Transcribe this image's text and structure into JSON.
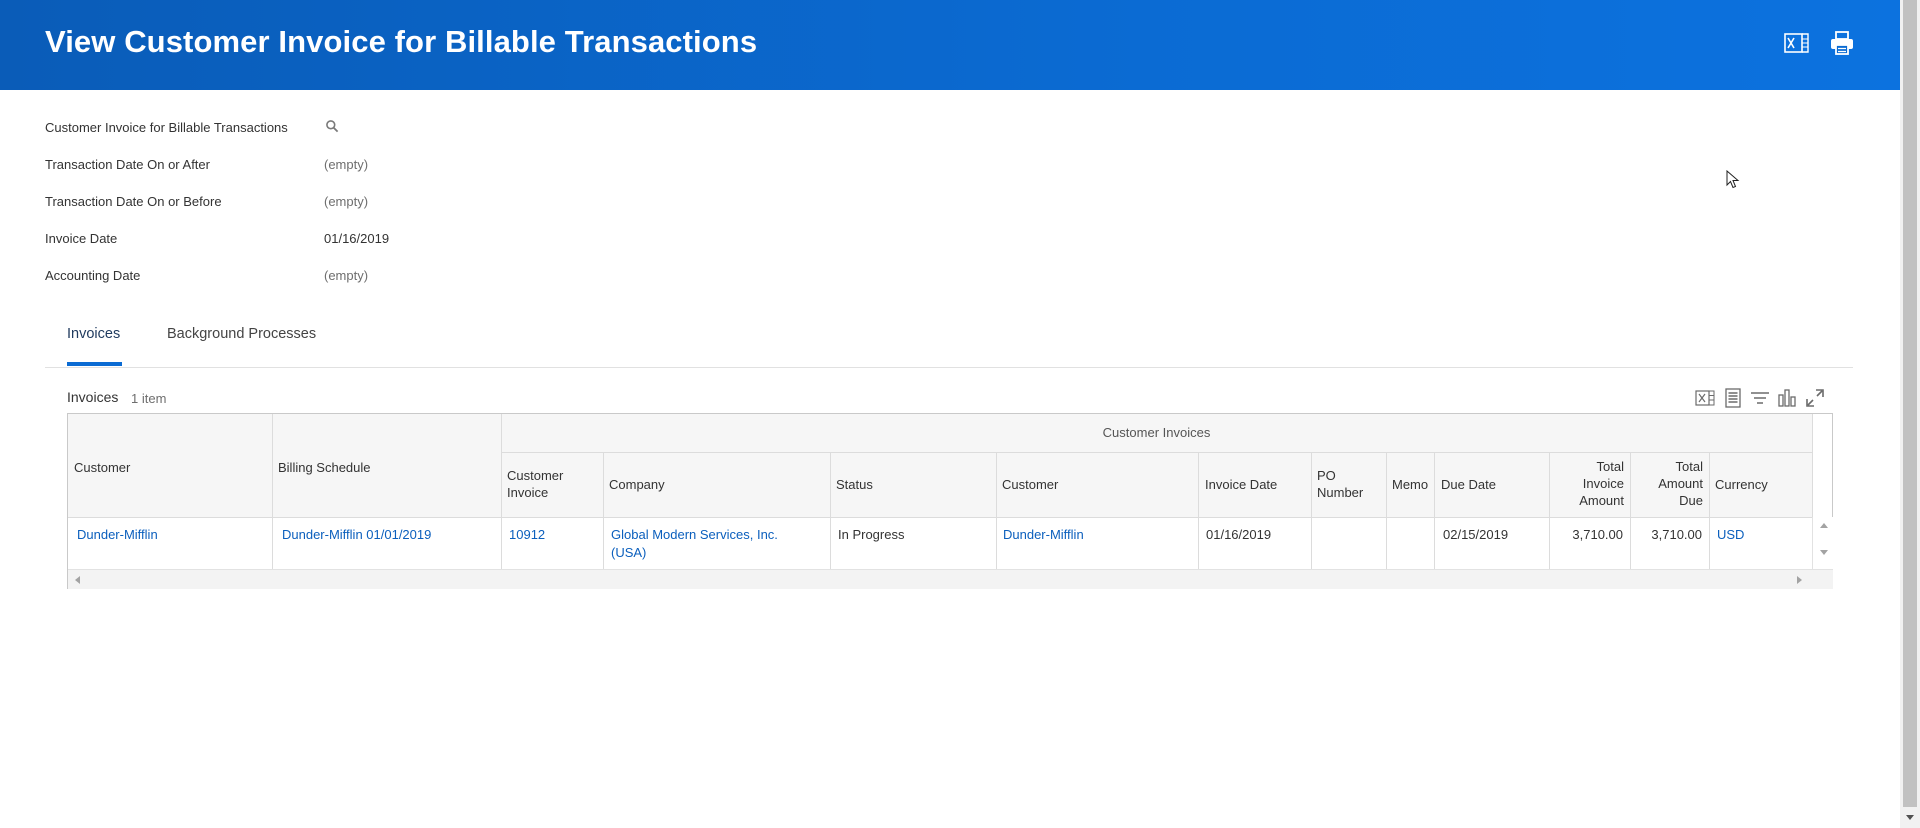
{
  "header": {
    "title": "View Customer Invoice for Billable Transactions",
    "background": "#0b6bd3",
    "icons": [
      "excel-export-icon",
      "print-icon"
    ]
  },
  "filters": [
    {
      "label": "Customer Invoice for Billable Transactions",
      "value": "",
      "has_search": true
    },
    {
      "label": "Transaction Date On or After",
      "value": "(empty)"
    },
    {
      "label": "Transaction Date On or Before",
      "value": "(empty)"
    },
    {
      "label": "Invoice Date",
      "value": "01/16/2019"
    },
    {
      "label": "Accounting Date",
      "value": "(empty)"
    }
  ],
  "tabs": [
    {
      "label": "Invoices",
      "active": true
    },
    {
      "label": "Background Processes",
      "active": false
    }
  ],
  "grid": {
    "title": "Invoices",
    "count": "1 item",
    "tool_icons": [
      "excel-export-icon",
      "table-view-icon",
      "filter-icon",
      "chart-icon",
      "fullscreen-icon"
    ],
    "group_header": "Customer Invoices",
    "headers": {
      "customer": "Customer",
      "billing_schedule": "Billing Schedule",
      "customer_invoice": [
        "Customer",
        "Invoice"
      ],
      "company": "Company",
      "status": "Status",
      "customer2": "Customer",
      "invoice_date": "Invoice Date",
      "po_number": [
        "PO",
        "Number"
      ],
      "memo": "Memo",
      "due_date": "Due Date",
      "total_invoice_amount": [
        "Total",
        "Invoice",
        "Amount"
      ],
      "total_amount_due": [
        "Total",
        "Amount",
        "Due"
      ],
      "currency": "Currency"
    },
    "rows": [
      {
        "customer": "Dunder-Mifflin",
        "billing_schedule": "Dunder-Mifflin 01/01/2019",
        "customer_invoice": "10912",
        "company": [
          "Global Modern Services, Inc.",
          "(USA)"
        ],
        "status": "In Progress",
        "customer2": "Dunder-Mifflin",
        "invoice_date": "01/16/2019",
        "po_number": "",
        "memo": "",
        "due_date": "02/15/2019",
        "total_invoice_amount": "3,710.00",
        "total_amount_due": "3,710.00",
        "currency": "USD"
      }
    ]
  },
  "colors": {
    "link": "#0b5fbd",
    "tab_active_underline": "#0b6bd3",
    "grid_border": "#c9c9c9"
  }
}
